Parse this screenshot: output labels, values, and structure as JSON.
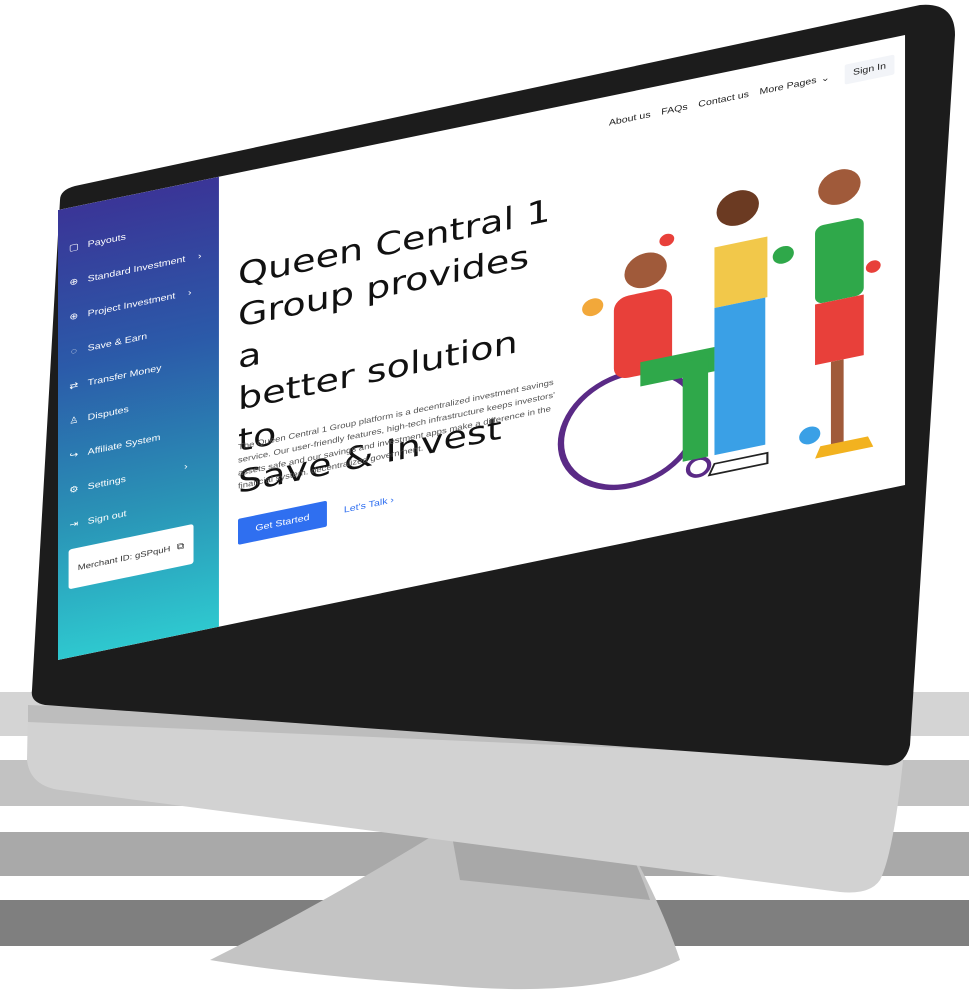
{
  "sidebar": {
    "items": [
      {
        "label": "Payouts",
        "icon": "wallet-icon"
      },
      {
        "label": "Standard Investment",
        "icon": "globe-icon",
        "chevron": "›"
      },
      {
        "label": "Project Investment",
        "icon": "globe-icon",
        "chevron": "›"
      },
      {
        "label": "Save & Earn",
        "icon": "piggy-bank-icon"
      },
      {
        "label": "Transfer Money",
        "icon": "shuffle-icon"
      },
      {
        "label": "Disputes",
        "icon": "user-icon"
      },
      {
        "label": "Affiliate System",
        "icon": "share-icon"
      },
      {
        "label": "Settings",
        "icon": "gear-icon",
        "chevron": "›"
      },
      {
        "label": "Sign out",
        "icon": "sign-out-icon"
      }
    ],
    "merchant_id": "Merchant ID: gSPquH"
  },
  "nav": {
    "about": "About us",
    "faqs": "FAQs",
    "contact": "Contact us",
    "more_pages": "More Pages",
    "sign_in": "Sign In"
  },
  "hero": {
    "title_line1": "Queen Central 1",
    "title_line2": "Group provides a",
    "title_line3": "better solution to",
    "title_line4": "Save & Invest",
    "description": "The Queen Central 1 Group platform is a decentralized investment savings service. Our user-friendly features, high-tech infrastructure keeps investors' assets safe and our savings and investment apps make a difference in the financial system. decentralized government.",
    "get_started": "Get Started",
    "lets_talk": "Let's Talk ›"
  },
  "colors": {
    "accent": "#2f6ff0",
    "sidebar_top": "#3a3597",
    "sidebar_bottom": "#2ec8cf",
    "monitor_bezel": "#1c1c1c",
    "monitor_body": "#d0d0d0"
  }
}
